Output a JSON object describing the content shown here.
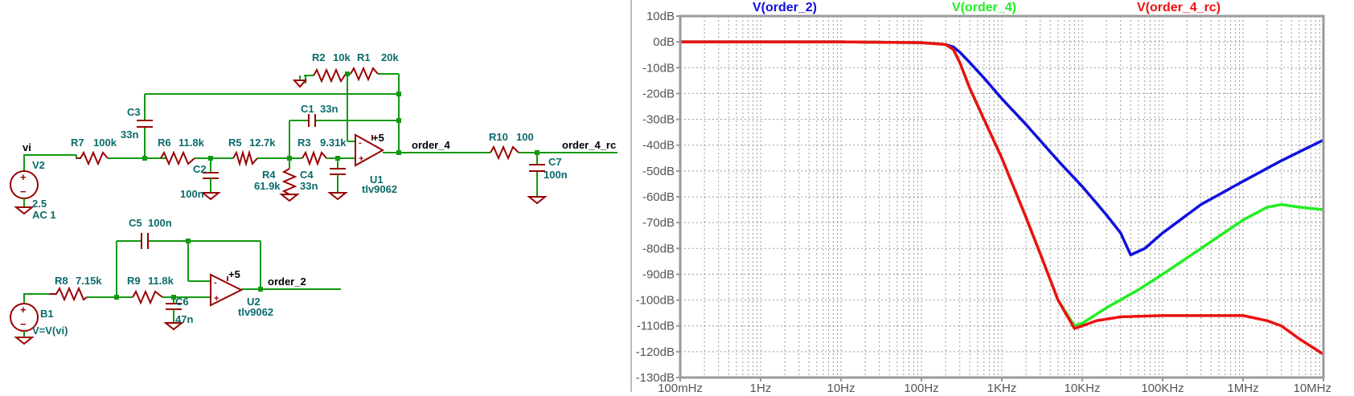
{
  "schematic": {
    "nets": {
      "vi": "vi",
      "order_4": "order_4",
      "order_4_rc": "order_4_rc",
      "order_2": "order_2"
    },
    "components": {
      "V2": {
        "name": "V2",
        "value": "2.5",
        "extra": "AC 1"
      },
      "B1": {
        "name": "B1",
        "value": "V=V(vi)"
      },
      "R1": {
        "name": "R1",
        "value": "20k"
      },
      "R2": {
        "name": "R2",
        "value": "10k"
      },
      "R3": {
        "name": "R3",
        "value": "9.31k"
      },
      "R4": {
        "name": "R4",
        "value": "61.9k"
      },
      "R5": {
        "name": "R5",
        "value": "12.7k"
      },
      "R6": {
        "name": "R6",
        "value": "11.8k"
      },
      "R7": {
        "name": "R7",
        "value": "100k"
      },
      "R8": {
        "name": "R8",
        "value": "7.15k"
      },
      "R9": {
        "name": "R9",
        "value": "11.8k"
      },
      "R10": {
        "name": "R10",
        "value": "100"
      },
      "C1": {
        "name": "C1",
        "value": "33n"
      },
      "C2": {
        "name": "C2",
        "value": "100n"
      },
      "C3": {
        "name": "C3",
        "value": "33n"
      },
      "C4": {
        "name": "C4",
        "value": "33n"
      },
      "C5": {
        "name": "C5",
        "value": "100n"
      },
      "C6": {
        "name": "C6",
        "value": "47n"
      },
      "C7": {
        "name": "C7",
        "value": "100n"
      },
      "U1": {
        "name": "U1",
        "value": "tlv9062",
        "supply": "+5"
      },
      "U2": {
        "name": "U2",
        "value": "tlv9062",
        "supply": "+5"
      }
    }
  },
  "plot": {
    "colors": {
      "order_2": "#1010e0",
      "order_4": "#22ee22",
      "order_4_rc": "#ee1111",
      "grid": "#9a9a9a",
      "frame": "#9a9a9a"
    },
    "chart_data": {
      "type": "line",
      "title": "",
      "xlabel": "",
      "ylabel": "",
      "x_scale": "log",
      "xlim_hz": [
        0.1,
        10000000
      ],
      "ylim_db": [
        -130,
        10
      ],
      "grid": true,
      "legend": "top",
      "x_ticks": [
        "100mHz",
        "1Hz",
        "10Hz",
        "100Hz",
        "1KHz",
        "10KHz",
        "100KHz",
        "1MHz",
        "10MHz"
      ],
      "y_ticks": [
        "10dB",
        "0dB",
        "-10dB",
        "-20dB",
        "-30dB",
        "-40dB",
        "-50dB",
        "-60dB",
        "-70dB",
        "-80dB",
        "-90dB",
        "-100dB",
        "-110dB",
        "-120dB",
        "-130dB"
      ],
      "series": [
        {
          "name": "V(order_2)",
          "x_hz": [
            0.1,
            10,
            100,
            200,
            250,
            300,
            400,
            600,
            1000,
            2000,
            5000,
            10000,
            20000,
            30000,
            40000,
            60000,
            100000,
            300000,
            1000000,
            3000000,
            10000000
          ],
          "y_db": [
            0,
            0,
            -0.3,
            -1,
            -2,
            -4,
            -8,
            -14,
            -22,
            -32,
            -46,
            -56,
            -67,
            -74,
            -82.5,
            -80,
            -74,
            -63,
            -54,
            -46,
            -38
          ]
        },
        {
          "name": "V(order_4)",
          "x_hz": [
            0.1,
            10,
            100,
            200,
            250,
            300,
            400,
            600,
            1000,
            2000,
            3000,
            5000,
            8000,
            10000,
            20000,
            50000,
            100000,
            300000,
            1000000,
            2000000,
            3000000,
            5000000,
            10000000
          ],
          "y_db": [
            0,
            0,
            -0.3,
            -1,
            -3,
            -8,
            -18,
            -30,
            -45,
            -68,
            -82,
            -100,
            -110,
            -109,
            -103,
            -96,
            -90,
            -80,
            -69,
            -64,
            -63,
            -64,
            -65
          ]
        },
        {
          "name": "V(order_4_rc)",
          "x_hz": [
            0.1,
            10,
            100,
            200,
            250,
            300,
            400,
            600,
            1000,
            2000,
            3000,
            5000,
            8000,
            10000,
            15000,
            30000,
            100000,
            500000,
            1000000,
            2000000,
            3000000,
            5000000,
            10000000
          ],
          "y_db": [
            0,
            0,
            -0.3,
            -1,
            -3,
            -8,
            -18,
            -30,
            -45,
            -68,
            -82,
            -100,
            -111,
            -110,
            -108,
            -106.5,
            -106,
            -106,
            -106,
            -108,
            -110,
            -115,
            -121
          ]
        }
      ]
    }
  }
}
